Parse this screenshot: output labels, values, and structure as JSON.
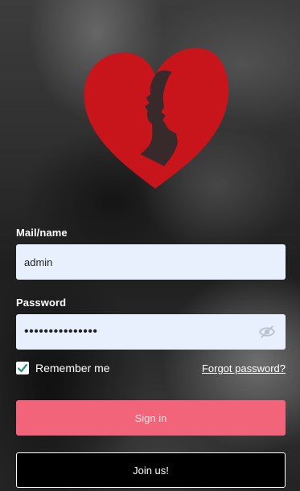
{
  "brand": {
    "logo": "heart-couple-logo",
    "accent_color": "#c8151b"
  },
  "form": {
    "mail_label": "Mail/name",
    "mail_value": "admin",
    "password_label": "Password",
    "password_value": "passwordpasswor",
    "password_visibility_icon": "eye-off-icon",
    "remember_label": "Remember me",
    "remember_checked": true,
    "forgot_label": "Forgot password?",
    "signin_label": "Sign in",
    "join_label": "Join us!"
  },
  "colors": {
    "signin_button": "#f2647a",
    "input_background": "#e8f0fe",
    "checkmark": "#2f8f8a"
  }
}
